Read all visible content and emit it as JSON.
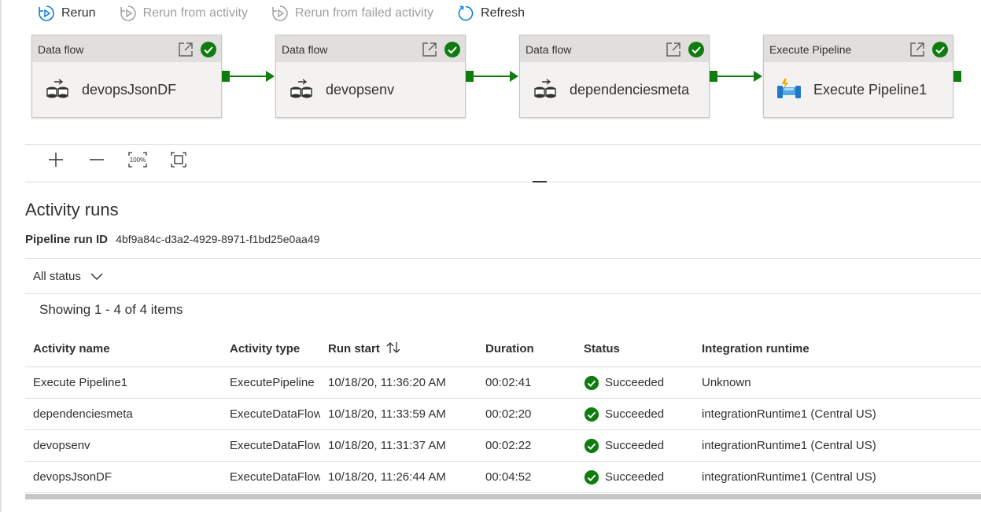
{
  "toolbar": {
    "rerun": "Rerun",
    "rerun_from_activity": "Rerun from activity",
    "rerun_from_failed": "Rerun from failed activity",
    "refresh": "Refresh"
  },
  "pipeline_nodes": [
    {
      "type": "Data flow",
      "name": "devopsJsonDF",
      "icon": "dataflow-icon"
    },
    {
      "type": "Data flow",
      "name": "devopsenv",
      "icon": "dataflow-icon"
    },
    {
      "type": "Data flow",
      "name": "dependenciesmeta",
      "icon": "dataflow-icon"
    },
    {
      "type": "Execute Pipeline",
      "name": "Execute Pipeline1",
      "icon": "execute-pipeline-icon"
    }
  ],
  "zoom": {
    "zoom_100_label": "100%"
  },
  "activity_runs": {
    "title": "Activity runs",
    "run_id_label": "Pipeline run ID",
    "run_id": "4bf9a84c-d3a2-4929-8971-f1bd25e0aa49",
    "status_filter": "All status",
    "showing": "Showing 1 - 4 of 4 items",
    "columns": [
      "Activity name",
      "Activity type",
      "Run start",
      "Duration",
      "Status",
      "Integration runtime"
    ],
    "rows": [
      {
        "name": "Execute Pipeline1",
        "type": "ExecutePipeline",
        "start": "10/18/20, 11:36:20 AM",
        "duration": "00:02:41",
        "status": "Succeeded",
        "runtime": "Unknown"
      },
      {
        "name": "dependenciesmeta",
        "type": "ExecuteDataFlow",
        "start": "10/18/20, 11:33:59 AM",
        "duration": "00:02:20",
        "status": "Succeeded",
        "runtime": "integrationRuntime1 (Central US)"
      },
      {
        "name": "devopsenv",
        "type": "ExecuteDataFlow",
        "start": "10/18/20, 11:31:37 AM",
        "duration": "00:02:22",
        "status": "Succeeded",
        "runtime": "integrationRuntime1 (Central US)"
      },
      {
        "name": "devopsJsonDF",
        "type": "ExecuteDataFlow",
        "start": "10/18/20, 11:26:44 AM",
        "duration": "00:04:52",
        "status": "Succeeded",
        "runtime": "integrationRuntime1 (Central US)"
      }
    ]
  },
  "colors": {
    "success": "#107c10",
    "accent": "#0078d4"
  }
}
